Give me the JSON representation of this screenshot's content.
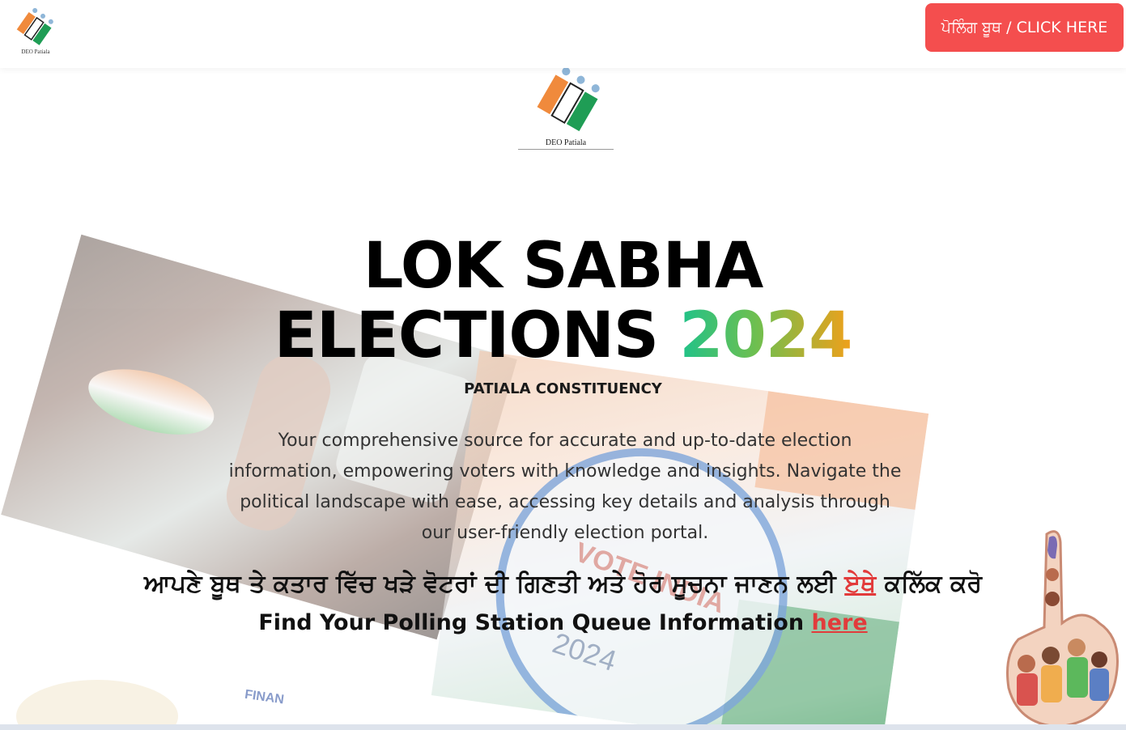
{
  "navbar": {
    "logo_caption": "DEO Patiala",
    "booth_button_label": "ਪੋਲਿੰਗ ਬੂਥ / CLICK HERE"
  },
  "center_logo": {
    "caption": "DEO Patiala"
  },
  "hero": {
    "title_line1": "LOK SABHA",
    "title_line2": "ELECTIONS",
    "title_year": "2024",
    "constituency": "PATIALA CONSTITUENCY",
    "description": "Your comprehensive source for accurate and up-to-date election information, empowering voters with knowledge and insights. Navigate the political landscape with ease, accessing key details and analysis through our user-friendly election portal.",
    "punjabi_prefix": "ਆਪਣੇ ਬੂਥ ਤੇ ਕਤਾਰ ਵਿੱਚ ਖੜੇ ਵੋਟਰਾਂ ਦੀ ਗਿਣਤੀ ਅਤੇ ਹੋਰ ਸੂਚਨਾ ਜਾਣਨ ਲਈ",
    "punjabi_link": "ਏਥੇ",
    "punjabi_suffix": "ਕਲਿੱਕ ਕਰੋ",
    "english_prefix": "Find Your Polling Station Queue Information",
    "english_link": "here"
  },
  "decor": {
    "vote_text": "VOTE INDIA",
    "year_text": "2024",
    "finance_text": "FINAN"
  },
  "colors": {
    "button_red": "#f44e4e",
    "link_red": "#e23b3b",
    "year_gradient_start": "#1fc28a",
    "year_gradient_end": "#f0a01a",
    "logo_saffron": "#f08a3c",
    "logo_green": "#1f9d55",
    "logo_blue": "#8fb6d8"
  }
}
